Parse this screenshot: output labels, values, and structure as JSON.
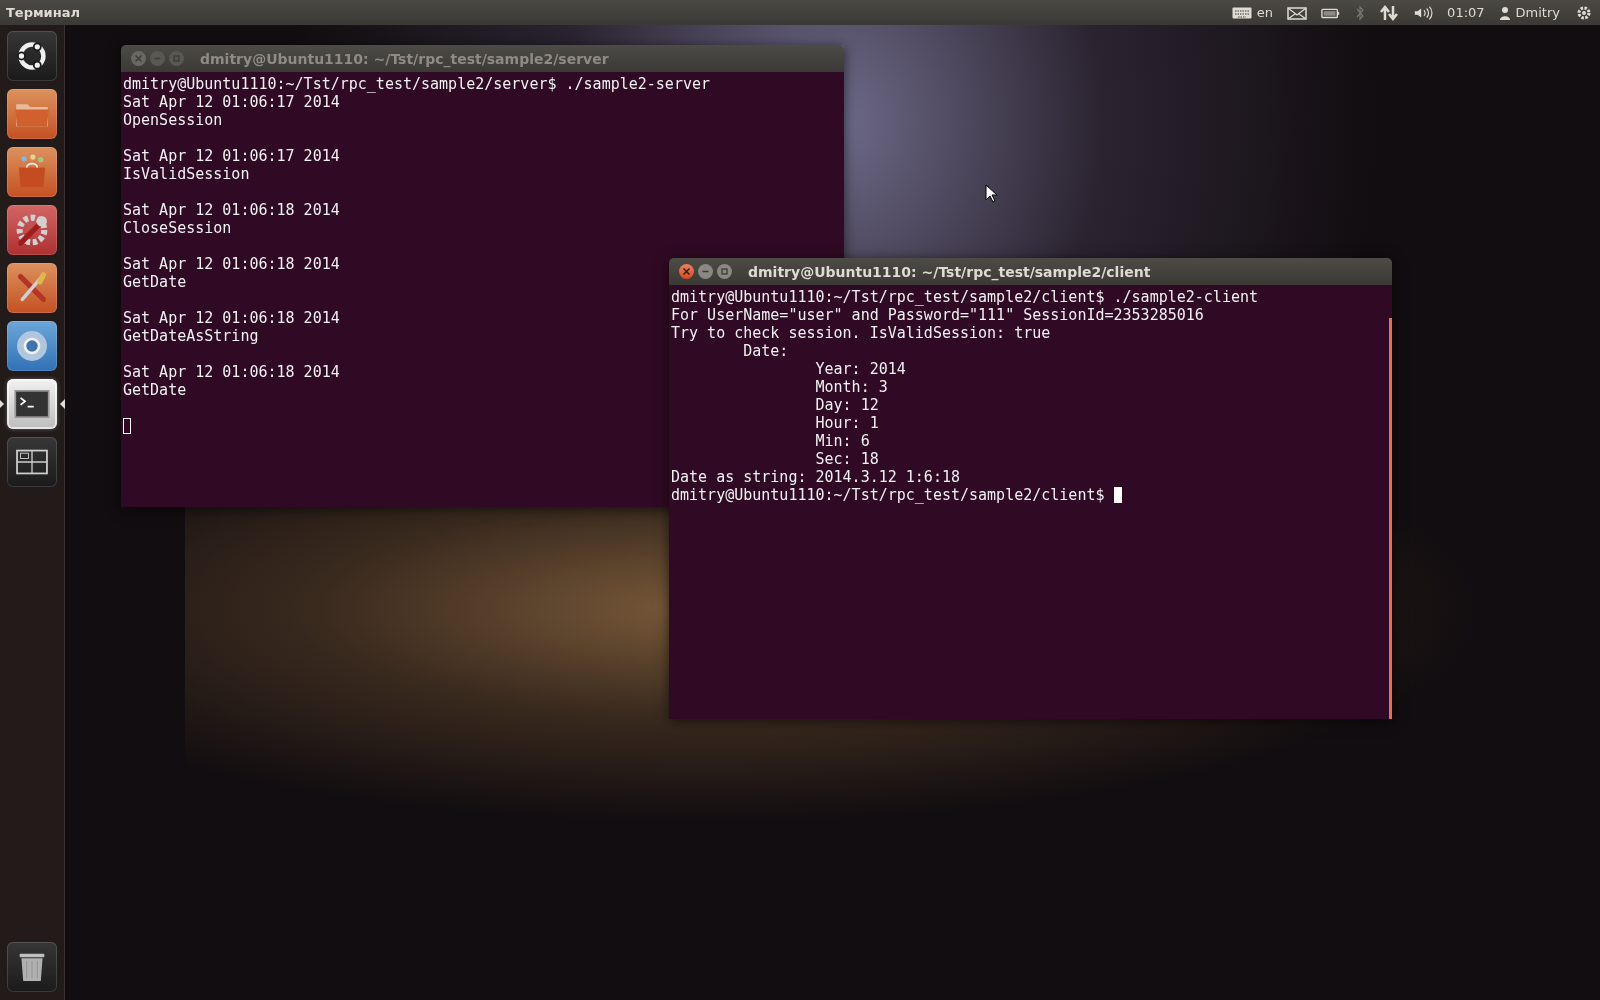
{
  "top_bar": {
    "app_title": "Терминал",
    "keyboard_layout": "en",
    "clock": "01:07",
    "user": "Dmitry"
  },
  "launcher": {
    "items": [
      {
        "kind": "dash",
        "running": false,
        "focused": false
      },
      {
        "kind": "files",
        "running": false,
        "focused": false
      },
      {
        "kind": "software-center",
        "running": false,
        "focused": false
      },
      {
        "kind": "system-settings",
        "running": false,
        "focused": false
      },
      {
        "kind": "tools",
        "running": false,
        "focused": false
      },
      {
        "kind": "browser",
        "running": false,
        "focused": false
      },
      {
        "kind": "terminal",
        "running": true,
        "focused": true
      },
      {
        "kind": "workspaces",
        "running": false,
        "focused": false
      },
      {
        "kind": "trash",
        "running": false,
        "focused": false
      }
    ]
  },
  "windows": [
    {
      "title": "dmitry@Ubuntu1110: ~/Tst/rpc_test/sample2/server",
      "focused": false,
      "cursor_on_own_line": true,
      "blocks": [
        [
          "dmitry@Ubuntu1110:~/Tst/rpc_test/sample2/server$ ./sample2-server",
          "Sat Apr 12 01:06:17 2014",
          "OpenSession"
        ],
        [
          "Sat Apr 12 01:06:17 2014",
          "IsValidSession"
        ],
        [
          "Sat Apr 12 01:06:18 2014",
          "CloseSession"
        ],
        [
          "Sat Apr 12 01:06:18 2014",
          "GetDate"
        ],
        [
          "Sat Apr 12 01:06:18 2014",
          "GetDateAsString"
        ],
        [
          "Sat Apr 12 01:06:18 2014",
          "GetDate"
        ]
      ]
    },
    {
      "title": "dmitry@Ubuntu1110: ~/Tst/rpc_test/sample2/client",
      "focused": true,
      "cursor_on_own_line": false,
      "blocks": [
        [
          "dmitry@Ubuntu1110:~/Tst/rpc_test/sample2/client$ ./sample2-client",
          "For UserName=\"user\" and Password=\"111\" SessionId=2353285016",
          "Try to check session. IsValidSession: true",
          "        Date:",
          "                Year: 2014",
          "                Month: 3",
          "                Day: 12",
          "                Hour: 1",
          "                Min: 6",
          "                Sec: 18",
          "Date as string: 2014.3.12 1:6:18",
          "dmitry@Ubuntu1110:~/Tst/rpc_test/sample2/client$ "
        ]
      ]
    }
  ]
}
